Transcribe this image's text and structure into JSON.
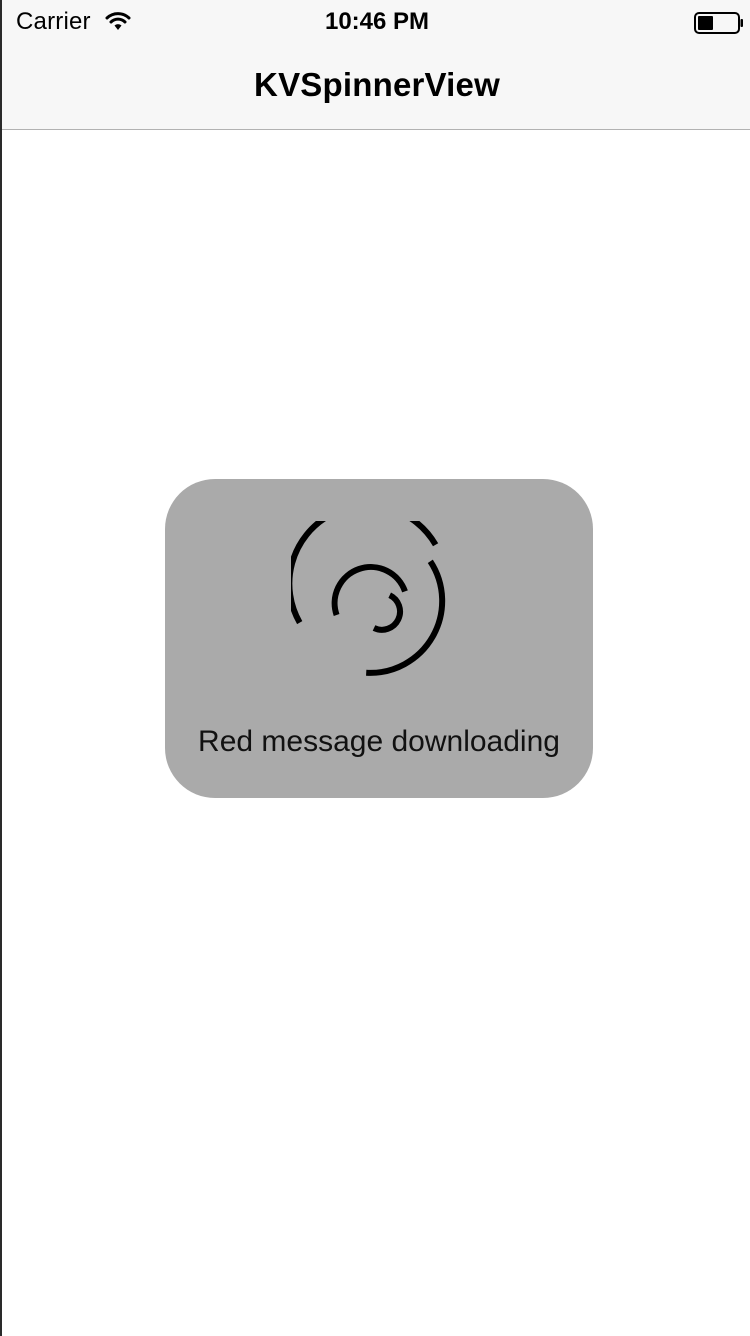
{
  "status_bar": {
    "carrier": "Carrier",
    "time": "10:46 PM",
    "wifi_icon": "wifi-icon",
    "battery_icon": "battery-icon"
  },
  "nav_bar": {
    "title": "KVSpinnerView"
  },
  "spinner_hud": {
    "icon": "spinner-icon",
    "message": "Red message downloading",
    "background_color": "#aaaaaa",
    "spinner_color": "#000000"
  }
}
